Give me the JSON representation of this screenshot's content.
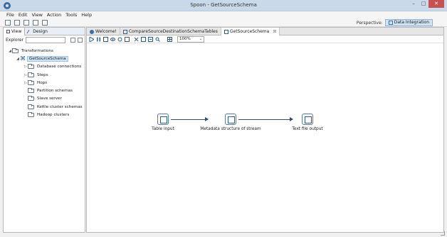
{
  "window": {
    "title": "Spoon - GetSourceSchema",
    "minimize": "–",
    "maximize": "□",
    "close": "✕"
  },
  "menubar": {
    "items": [
      "File",
      "Edit",
      "View",
      "Action",
      "Tools",
      "Help"
    ]
  },
  "toolbar": {
    "perspective_label": "Perspective:",
    "perspective_value": "Data Integration"
  },
  "left_panel": {
    "tabs": [
      "View",
      "Design"
    ],
    "explorer_label": "Explorer",
    "search_value": "",
    "tree": [
      {
        "label": "Transformations",
        "level": 0,
        "twisty": "◢"
      },
      {
        "label": "GetSourceSchema",
        "level": 1,
        "twisty": "◢",
        "selected": true
      },
      {
        "label": "Database connections",
        "level": 2,
        "twisty": "▷"
      },
      {
        "label": "Steps",
        "level": 2,
        "twisty": "▷"
      },
      {
        "label": "Hops",
        "level": 2,
        "twisty": "▷"
      },
      {
        "label": "Partition schemas",
        "level": 2,
        "twisty": ""
      },
      {
        "label": "Slave server",
        "level": 2,
        "twisty": ""
      },
      {
        "label": "Kettle cluster schemas",
        "level": 2,
        "twisty": ""
      },
      {
        "label": "Hadoop clusters",
        "level": 2,
        "twisty": ""
      }
    ]
  },
  "editor": {
    "tabs": [
      {
        "label": "Welcome!",
        "active": false
      },
      {
        "label": "CompareSourceDestinationSchemaTables",
        "active": false
      },
      {
        "label": "GetSourceSchema",
        "active": true,
        "close": "⊠"
      }
    ],
    "zoom": "100%",
    "steps": [
      "Table input",
      "Metadata structure of stream",
      "Text file output"
    ]
  }
}
